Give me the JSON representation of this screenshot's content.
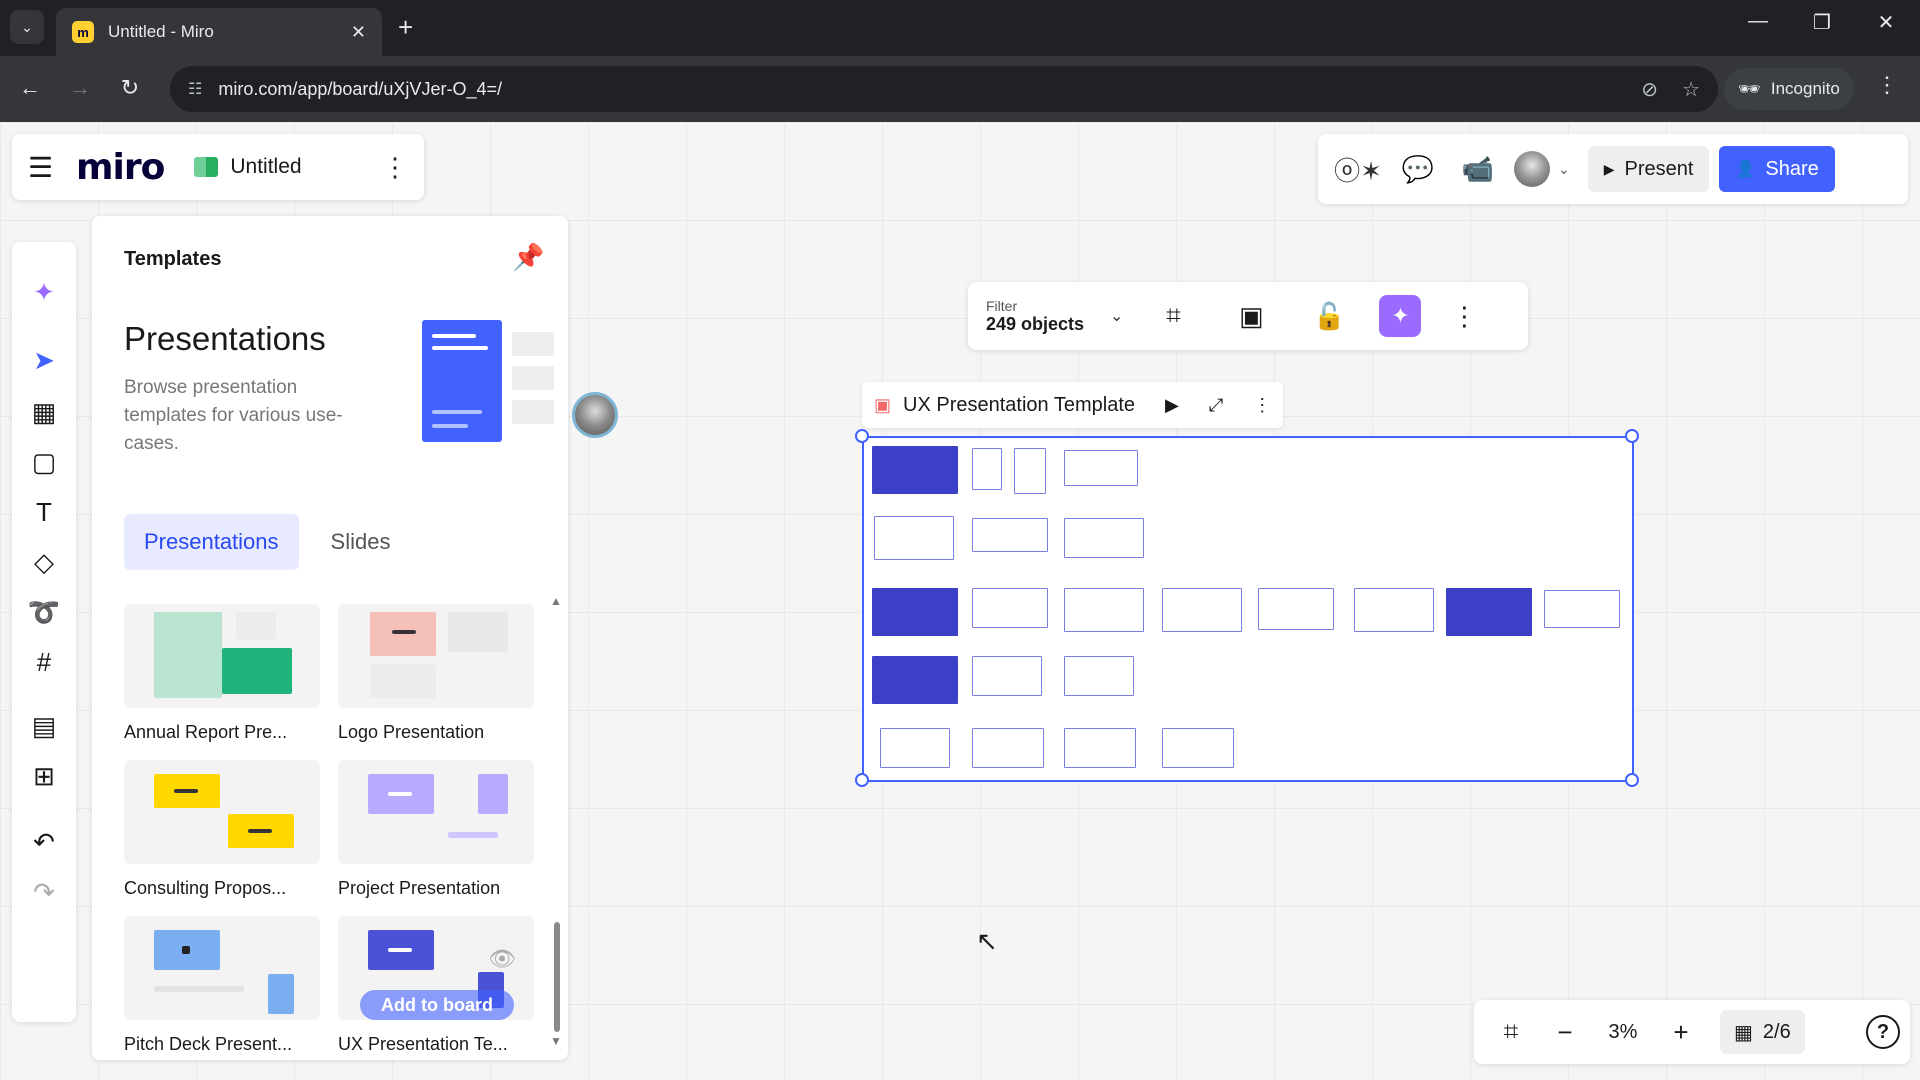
{
  "browser": {
    "tab_title": "Untitled - Miro",
    "url": "miro.com/app/board/uXjVJer-O_4=/",
    "incognito_label": "Incognito"
  },
  "board": {
    "logo": "miro",
    "title": "Untitled"
  },
  "top_right": {
    "present_label": "Present",
    "share_label": "Share"
  },
  "templates_panel": {
    "header": "Templates",
    "heading": "Presentations",
    "description": "Browse presentation templates for various use-cases.",
    "tabs": [
      "Presentations",
      "Slides"
    ],
    "active_tab": "Presentations",
    "cards": [
      {
        "label": "Annual Report Pre..."
      },
      {
        "label": "Logo Presentation"
      },
      {
        "label": "Consulting Propos..."
      },
      {
        "label": "Project Presentation"
      },
      {
        "label": "Pitch Deck Present..."
      },
      {
        "label": "UX Presentation Te..."
      }
    ],
    "add_to_board_label": "Add to board"
  },
  "selection_toolbar": {
    "filter_label": "Filter",
    "filter_value": "249 objects"
  },
  "frame": {
    "title": "UX Presentation Template"
  },
  "bottom_bar": {
    "zoom": "3%",
    "pages": "2/6"
  },
  "colors": {
    "accent": "#4262ff",
    "frame_slide": "#3d3fc7",
    "ai_button": "#9b6bff"
  }
}
